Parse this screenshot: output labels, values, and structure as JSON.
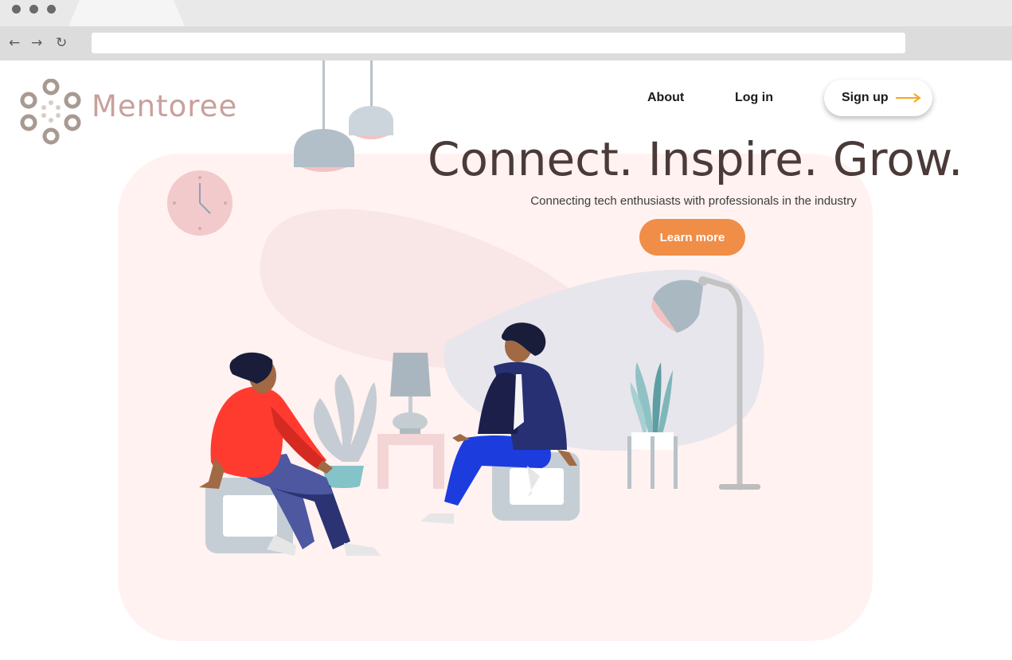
{
  "browser": {
    "back_icon": "←",
    "forward_icon": "→",
    "reload_icon": "↻",
    "address": ""
  },
  "brand": {
    "name": "Mentoree",
    "logo_color": "#a89a92"
  },
  "nav": {
    "about": "About",
    "login": "Log in",
    "signup": "Sign up",
    "signup_arrow_color": "#f5a623"
  },
  "hero": {
    "headline": "Connect. Inspire. Grow.",
    "subline": "Connecting tech enthusiasts with professionals in the industry",
    "cta": "Learn more",
    "cta_color": "#f08d47",
    "background_color": "#fff2f1"
  },
  "illustration": {
    "subject": "two people sitting and talking in a room with lamps, plants and a clock"
  }
}
